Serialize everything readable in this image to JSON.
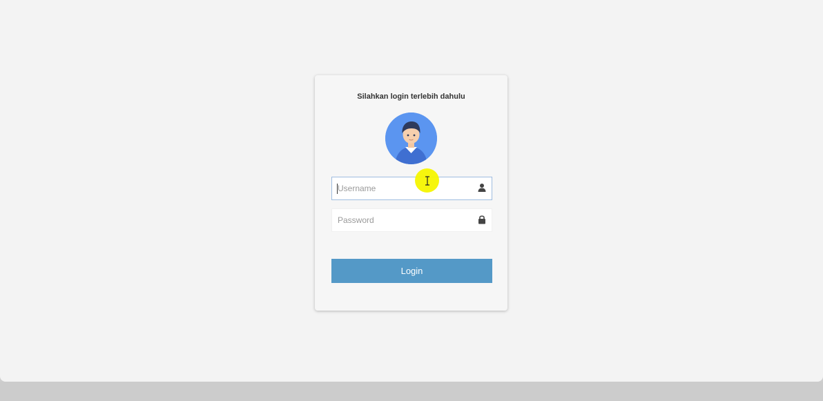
{
  "login": {
    "title": "Silahkan login terlebih dahulu",
    "username_placeholder": "Username",
    "password_placeholder": "Password",
    "login_label": "Login"
  },
  "icons": {
    "avatar": "user-avatar-icon",
    "username": "user-icon",
    "password": "lock-icon",
    "cursor": "text-cursor-icon"
  },
  "colors": {
    "accent": "#5499c7",
    "avatar_bg": "#5b95f0",
    "cursor_highlight": "#f5f500"
  }
}
